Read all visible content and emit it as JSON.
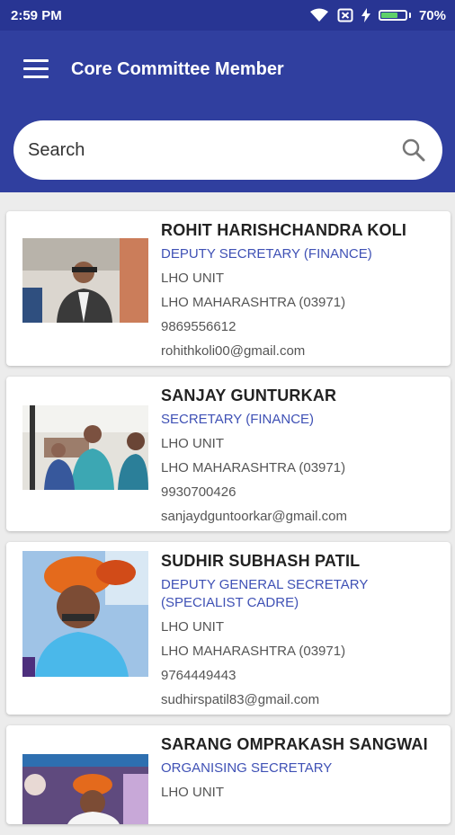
{
  "status_bar": {
    "time": "2:59 PM",
    "battery": "70%",
    "icons": [
      "wifi-icon",
      "no-sim-icon",
      "charging-icon",
      "battery-icon"
    ]
  },
  "app_bar": {
    "title": "Core Committee Member",
    "menu_icon": "hamburger-menu-icon"
  },
  "search": {
    "placeholder": "Search",
    "icon": "search-icon"
  },
  "members": [
    {
      "name": "ROHIT HARISHCHANDRA KOLI",
      "designation": "DEPUTY SECRETARY (FINANCE)",
      "unit": "LHO UNIT",
      "circle": "LHO MAHARASHTRA (03971)",
      "phone": "9869556612",
      "email": "rohithkoli00@gmail.com"
    },
    {
      "name": "SANJAY GUNTURKAR",
      "designation": "SECRETARY (FINANCE)",
      "unit": "LHO UNIT",
      "circle": "LHO MAHARASHTRA (03971)",
      "phone": "9930700426",
      "email": "sanjaydguntoorkar@gmail.com"
    },
    {
      "name": "SUDHIR SUBHASH PATIL",
      "designation": "DEPUTY GENERAL SECRETARY (SPECIALIST CADRE)",
      "unit": "LHO UNIT",
      "circle": "LHO MAHARASHTRA (03971)",
      "phone": "9764449443",
      "email": "sudhirspatil83@gmail.com"
    },
    {
      "name": "SARANG OMPRAKASH SANGWAI",
      "designation": "ORGANISING SECRETARY",
      "unit": "LHO UNIT"
    }
  ],
  "colors": {
    "status_bar": "#283593",
    "app_bar": "#303f9f",
    "designation": "#3f51b5",
    "background": "#ececec"
  }
}
